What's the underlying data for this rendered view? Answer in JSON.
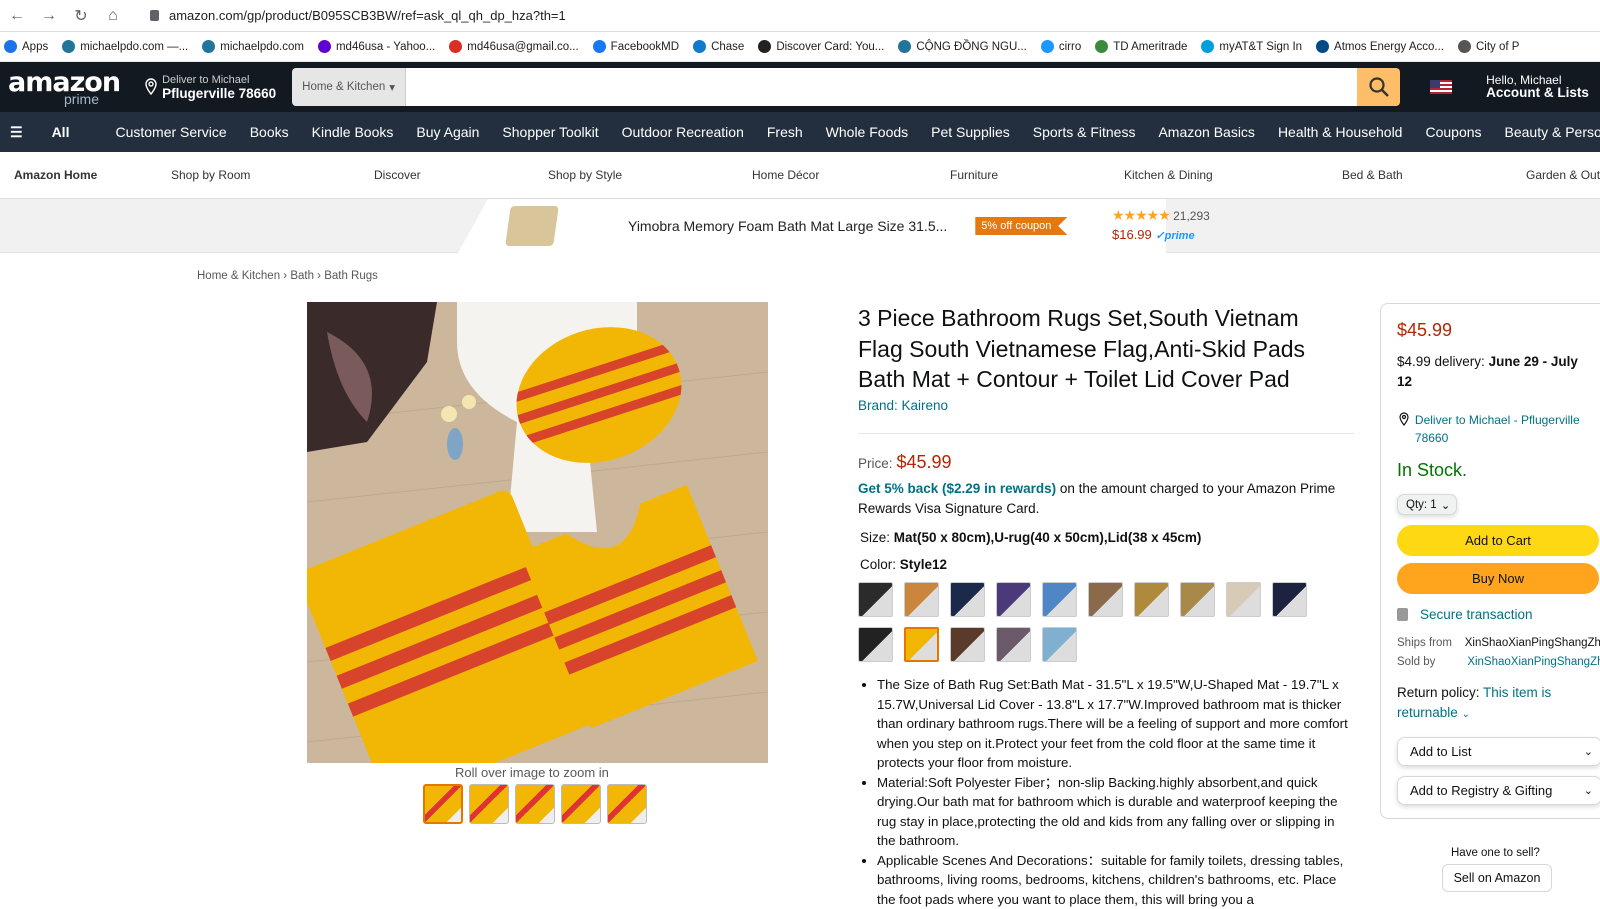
{
  "browser": {
    "url": "amazon.com/gp/product/B095SCB3BW/ref=ask_ql_qh_dp_hza?th=1"
  },
  "bookmarks": [
    {
      "label": "Apps",
      "color": "#1a73e8"
    },
    {
      "label": "michaelpdo.com —...",
      "color": "#21759b"
    },
    {
      "label": "michaelpdo.com",
      "color": "#21759b"
    },
    {
      "label": "md46usa - Yahoo...",
      "color": "#6001d2"
    },
    {
      "label": "md46usa@gmail.co...",
      "color": "#d93025"
    },
    {
      "label": "FacebookMD",
      "color": "#1877f2"
    },
    {
      "label": "Chase",
      "color": "#117aca"
    },
    {
      "label": "Discover Card: You...",
      "color": "#222222"
    },
    {
      "label": "CỘNG ĐỒNG NGU...",
      "color": "#21759b"
    },
    {
      "label": "cirro",
      "color": "#1a98ff"
    },
    {
      "label": "TD Ameritrade",
      "color": "#3b8a3e"
    },
    {
      "label": "myAT&T Sign In",
      "color": "#009fdb"
    },
    {
      "label": "Atmos Energy Acco...",
      "color": "#004b87"
    },
    {
      "label": "City of P",
      "color": "#555555"
    }
  ],
  "header": {
    "logo": "amazon",
    "prime": "prime",
    "deliver_line1": "Deliver to Michael",
    "deliver_line2": "Pflugerville 78660",
    "search_category": "Home & Kitchen",
    "account_line1": "Hello, Michael",
    "account_line2": "Account & Lists"
  },
  "nav": {
    "all": "All",
    "items": [
      "Customer Service",
      "Books",
      "Kindle Books",
      "Buy Again",
      "Shopper Toolkit",
      "Outdoor Recreation",
      "Fresh",
      "Whole Foods",
      "Pet Supplies",
      "Sports & Fitness",
      "Amazon Basics",
      "Health & Household",
      "Coupons",
      "Beauty & Personal Care"
    ]
  },
  "subnav": [
    "Amazon Home",
    "Shop by Room",
    "Discover",
    "Shop by Style",
    "Home Décor",
    "Furniture",
    "Kitchen & Dining",
    "Bed & Bath",
    "Garden & Outdoor"
  ],
  "promo": {
    "title": "Yimobra Memory Foam Bath Mat Large Size 31.5...",
    "coupon": "5% off coupon",
    "stars": "★★★★★",
    "rating_count": "21,293",
    "price": "$16.99",
    "prime": "✓prime"
  },
  "breadcrumb": "Home & Kitchen › Bath › Bath Rugs",
  "product": {
    "title": "3 Piece Bathroom Rugs Set,South Vietnam Flag South Vietnamese Flag,Anti-Skid Pads Bath Mat + Contour + Toilet Lid Cover Pad",
    "brand": "Brand: Kaireno",
    "price_label": "Price:",
    "price": "$45.99",
    "reward_link": "Get 5% back ($2.29 in rewards)",
    "reward_text": " on the amount charged to your Amazon Prime Rewards Visa Signature Card.",
    "size_label": "Size: ",
    "size_value": "Mat(50 x 80cm),U-rug(40 x 50cm),Lid(38 x 45cm)",
    "color_label": "Color: ",
    "color_value": "Style12",
    "zoom_hint": "Roll over image to zoom in",
    "swatch_colors": [
      "#2b2b2b",
      "#c9863c",
      "#1b2a4a",
      "#4a3a7a",
      "#4f86c6",
      "#8a6a4a",
      "#b08a3c",
      "#a8894a",
      "#d7cbb8",
      "#1c2240",
      "#222",
      "#f2b705",
      "#5a3a2a",
      "#6b5a6a",
      "#7fb0d0"
    ],
    "bullets": [
      "The Size of Bath Rug Set:Bath Mat - 31.5\"L x 19.5\"W,U-Shaped Mat - 19.7\"L x 15.7W,Universal Lid Cover - 13.8\"L x 17.7\"W.Improved bathroom mat is thicker than ordinary bathroom rugs.There will be a feeling of support and more comfort when you step on it.Protect your feet from the cold floor at the same time it protects your floor from moisture.",
      "Material:Soft Polyester Fiber；non-slip Backing.highly absorbent,and quick drying.Our bath mat for bathroom which is durable and waterproof keeping the rug stay in place,protecting the old and kids from any falling over or slipping in the bathroom.",
      "Applicable Scenes And Decorations：suitable for family toilets, dressing tables, bathrooms, living rooms, bedrooms, kitchens, children's bathrooms, etc. Place the foot pads where you want to place them, this will bring you a"
    ]
  },
  "buybox": {
    "price": "$45.99",
    "delivery_prefix": "$4.99 delivery: ",
    "delivery_dates": "June 29 - July 12",
    "deliver_to": "Deliver to Michael - Pflugerville 78660",
    "stock": "In Stock.",
    "qty": "Qty: 1",
    "add_to_cart": "Add to Cart",
    "buy_now": "Buy Now",
    "secure": "Secure transaction",
    "ships_from_label": "Ships from",
    "ships_from": "XinShaoXianPingShangZhu",
    "sold_by_label": "Sold by",
    "sold_by": "XinShaoXianPingShangZhu",
    "return_label": "Return policy: ",
    "return_link": "This item is returnable",
    "add_to_list": "Add to List",
    "add_registry": "Add to Registry & Gifting",
    "have_one": "Have one to sell?",
    "sell": "Sell on Amazon"
  }
}
